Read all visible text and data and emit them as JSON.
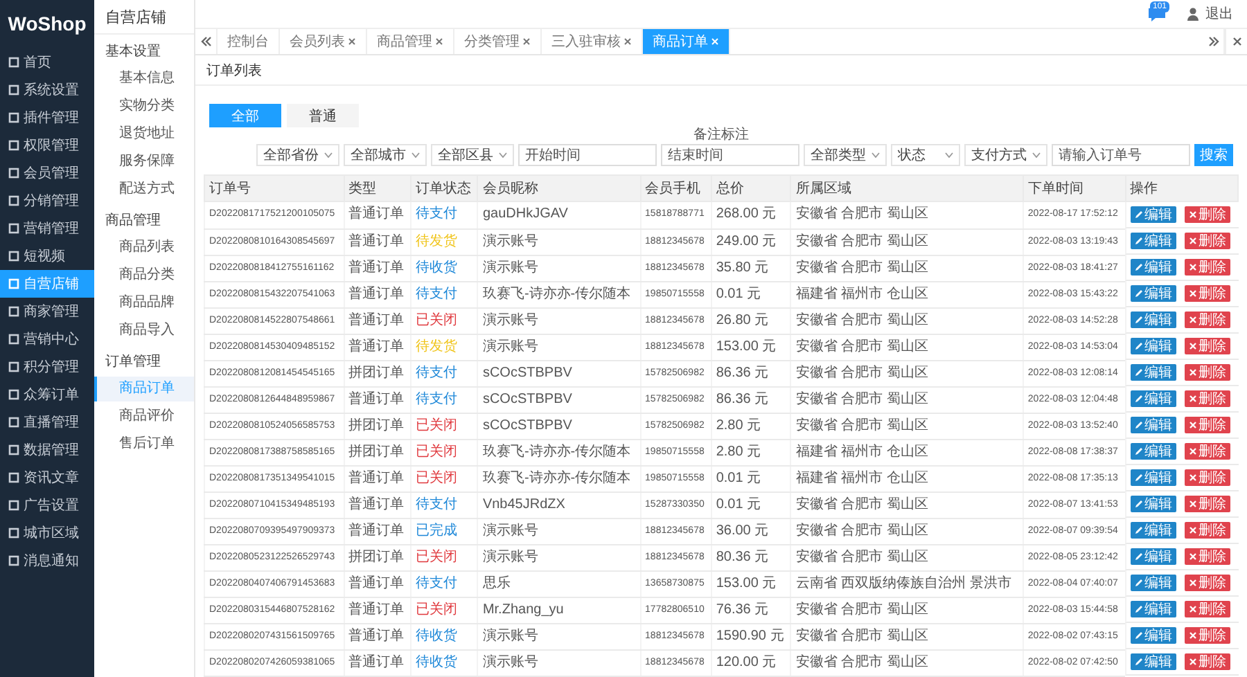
{
  "sidebar": {
    "logo": "WoShop",
    "items": [
      {
        "label": "首页",
        "selected": false
      },
      {
        "label": "系统设置",
        "selected": false
      },
      {
        "label": "插件管理",
        "selected": false
      },
      {
        "label": "权限管理",
        "selected": false
      },
      {
        "label": "会员管理",
        "selected": false
      },
      {
        "label": "分销管理",
        "selected": false
      },
      {
        "label": "营销管理",
        "selected": false
      },
      {
        "label": "短视频",
        "selected": false
      },
      {
        "label": "自营店铺",
        "selected": true
      },
      {
        "label": "商家管理",
        "selected": false
      },
      {
        "label": "营销中心",
        "selected": false
      },
      {
        "label": "积分管理",
        "selected": false
      },
      {
        "label": "众筹订单",
        "selected": false
      },
      {
        "label": "直播管理",
        "selected": false
      },
      {
        "label": "数据管理",
        "selected": false
      },
      {
        "label": "资讯文章",
        "selected": false
      },
      {
        "label": "广告设置",
        "selected": false
      },
      {
        "label": "城市区域",
        "selected": false
      },
      {
        "label": "消息通知",
        "selected": false
      }
    ]
  },
  "subnav": {
    "title": "自营店铺",
    "groups": [
      {
        "label": "基本设置",
        "items": [
          {
            "label": "基本信息",
            "selected": false
          },
          {
            "label": "实物分类",
            "selected": false
          },
          {
            "label": "退货地址",
            "selected": false
          },
          {
            "label": "服务保障",
            "selected": false
          },
          {
            "label": "配送方式",
            "selected": false
          }
        ]
      },
      {
        "label": "商品管理",
        "items": [
          {
            "label": "商品列表",
            "selected": false
          },
          {
            "label": "商品分类",
            "selected": false
          },
          {
            "label": "商品品牌",
            "selected": false
          },
          {
            "label": "商品导入",
            "selected": false
          }
        ]
      },
      {
        "label": "订单管理",
        "items": [
          {
            "label": "商品订单",
            "selected": true
          },
          {
            "label": "商品评价",
            "selected": false
          },
          {
            "label": "售后订单",
            "selected": false
          }
        ]
      }
    ]
  },
  "header": {
    "badge": "101",
    "logout": "退出"
  },
  "tabs": [
    {
      "label": "控制台",
      "selected": false,
      "closable": false
    },
    {
      "label": "会员列表",
      "selected": false,
      "closable": true
    },
    {
      "label": "商品管理",
      "selected": false,
      "closable": true
    },
    {
      "label": "分类管理",
      "selected": false,
      "closable": true
    },
    {
      "label": "三入驻审核",
      "selected": false,
      "closable": true
    },
    {
      "label": "商品订单",
      "selected": true,
      "closable": true
    }
  ],
  "page_title": "订单列表",
  "type_buttons": [
    {
      "label": "全部",
      "selected": true
    },
    {
      "label": "普通",
      "selected": false
    }
  ],
  "filters": {
    "label": "备注标注",
    "controls": [
      {
        "kind": "select",
        "text": "全部省份"
      },
      {
        "kind": "select",
        "text": "全部城市"
      },
      {
        "kind": "select",
        "text": "全部区县"
      },
      {
        "kind": "input",
        "placeholder": "开始时间"
      },
      {
        "kind": "input",
        "placeholder": "结束时间"
      },
      {
        "kind": "select",
        "text": "全部类型"
      },
      {
        "kind": "select",
        "text": "状态"
      },
      {
        "kind": "select",
        "text": "支付方式"
      },
      {
        "kind": "input",
        "placeholder": "请输入订单号"
      },
      {
        "kind": "button",
        "text": "搜索"
      }
    ]
  },
  "table": {
    "columns": [
      "订单号",
      "类型",
      "订单状态",
      "会员昵称",
      "会员手机",
      "总价",
      "所属区域",
      "下单时间",
      "操作"
    ],
    "rows": [
      {
        "order_no": "D2022081717521200105075",
        "type": "普通订单",
        "status": {
          "text": "待支付",
          "color": "#1e88d8"
        },
        "nickname": "gauDHkJGAV",
        "phone": "15818788771",
        "total": "268.00 元",
        "region": "安徽省 合肥市 蜀山区",
        "time": "2022-08-17 17:52:12",
        "edit": "编辑",
        "delete": "删除"
      },
      {
        "order_no": "D2022080810164308545697",
        "type": "普通订单",
        "status": {
          "text": "待发货",
          "color": "#f0c419"
        },
        "nickname": "演示账号",
        "phone": "18812345678",
        "total": "249.00 元",
        "region": "安徽省 合肥市 蜀山区",
        "time": "2022-08-03 13:19:43",
        "edit": "编辑",
        "delete": "删除"
      },
      {
        "order_no": "D2022080818412755161162",
        "type": "普通订单",
        "status": {
          "text": "待收货",
          "color": "#1e88d8"
        },
        "nickname": "演示账号",
        "phone": "18812345678",
        "total": "35.80 元",
        "region": "安徽省 合肥市 蜀山区",
        "time": "2022-08-03 18:41:27",
        "edit": "编辑",
        "delete": "删除"
      },
      {
        "order_no": "D2022080815432207541063",
        "type": "普通订单",
        "status": {
          "text": "待支付",
          "color": "#1e88d8"
        },
        "nickname": "玖赛飞-诗亦亦-传尔随本",
        "phone": "19850715558",
        "total": "0.01 元",
        "region": "福建省 福州市 仓山区",
        "time": "2022-08-03 15:43:22",
        "edit": "编辑",
        "delete": "删除"
      },
      {
        "order_no": "D2022080814522807548661",
        "type": "普通订单",
        "status": {
          "text": "已关闭",
          "color": "#e0393e"
        },
        "nickname": "演示账号",
        "phone": "18812345678",
        "total": "26.80 元",
        "region": "安徽省 合肥市 蜀山区",
        "time": "2022-08-03 14:52:28",
        "edit": "编辑",
        "delete": "删除"
      },
      {
        "order_no": "D2022080814530409485152",
        "type": "普通订单",
        "status": {
          "text": "待发货",
          "color": "#f0c419"
        },
        "nickname": "演示账号",
        "phone": "18812345678",
        "total": "153.00 元",
        "region": "安徽省 合肥市 蜀山区",
        "time": "2022-08-03 14:53:04",
        "edit": "编辑",
        "delete": "删除"
      },
      {
        "order_no": "D2022080812081454545165",
        "type": "拼团订单",
        "status": {
          "text": "待支付",
          "color": "#1e88d8"
        },
        "nickname": "sCOcSTBPBV",
        "phone": "15782506982",
        "total": "86.36 元",
        "region": "安徽省 合肥市 蜀山区",
        "time": "2022-08-03 12:08:14",
        "edit": "编辑",
        "delete": "删除"
      },
      {
        "order_no": "D2022080812644848959867",
        "type": "普通订单",
        "status": {
          "text": "待支付",
          "color": "#1e88d8"
        },
        "nickname": "sCOcSTBPBV",
        "phone": "15782506982",
        "total": "86.36 元",
        "region": "安徽省 合肥市 蜀山区",
        "time": "2022-08-03 12:04:48",
        "edit": "编辑",
        "delete": "删除"
      },
      {
        "order_no": "D2022080810524056585753",
        "type": "拼团订单",
        "status": {
          "text": "已关闭",
          "color": "#e0393e"
        },
        "nickname": "sCOcSTBPBV",
        "phone": "15782506982",
        "total": "2.80 元",
        "region": "安徽省 合肥市 蜀山区",
        "time": "2022-08-03 13:52:40",
        "edit": "编辑",
        "delete": "删除"
      },
      {
        "order_no": "D2022080817388758585165",
        "type": "拼团订单",
        "status": {
          "text": "已关闭",
          "color": "#e0393e"
        },
        "nickname": "玖赛飞-诗亦亦-传尔随本",
        "phone": "19850715558",
        "total": "2.80 元",
        "region": "福建省 福州市 仓山区",
        "time": "2022-08-08 17:38:37",
        "edit": "编辑",
        "delete": "删除"
      },
      {
        "order_no": "D2022080817351349541015",
        "type": "普通订单",
        "status": {
          "text": "已关闭",
          "color": "#e0393e"
        },
        "nickname": "玖赛飞-诗亦亦-传尔随本",
        "phone": "19850715558",
        "total": "0.01 元",
        "region": "福建省 福州市 仓山区",
        "time": "2022-08-08 17:35:13",
        "edit": "编辑",
        "delete": "删除"
      },
      {
        "order_no": "D2022080710415349485193",
        "type": "普通订单",
        "status": {
          "text": "待支付",
          "color": "#1e88d8"
        },
        "nickname": "Vnb45JRdZX",
        "phone": "15287330350",
        "total": "0.01 元",
        "region": "安徽省 合肥市 蜀山区",
        "time": "2022-08-07 13:41:53",
        "edit": "编辑",
        "delete": "删除"
      },
      {
        "order_no": "D2022080709395497909373",
        "type": "普通订单",
        "status": {
          "text": "已完成",
          "color": "#1e88d8"
        },
        "nickname": "演示账号",
        "phone": "18812345678",
        "total": "36.00 元",
        "region": "安徽省 合肥市 蜀山区",
        "time": "2022-08-07 09:39:54",
        "edit": "编辑",
        "delete": "删除"
      },
      {
        "order_no": "D2022080523122526529743",
        "type": "拼团订单",
        "status": {
          "text": "已关闭",
          "color": "#e0393e"
        },
        "nickname": "演示账号",
        "phone": "18812345678",
        "total": "80.36 元",
        "region": "安徽省 合肥市 蜀山区",
        "time": "2022-08-05 23:12:42",
        "edit": "编辑",
        "delete": "删除"
      },
      {
        "order_no": "D2022080407406791453683",
        "type": "普通订单",
        "status": {
          "text": "待支付",
          "color": "#1e88d8"
        },
        "nickname": "思乐",
        "phone": "13658730875",
        "total": "153.00 元",
        "region": "云南省 西双版纳傣族自治州 景洪市",
        "time": "2022-08-04 07:40:07",
        "edit": "编辑",
        "delete": "删除"
      },
      {
        "order_no": "D2022080315446807528162",
        "type": "普通订单",
        "status": {
          "text": "已关闭",
          "color": "#e0393e"
        },
        "nickname": "Mr.Zhang_yu",
        "phone": "17782806510",
        "total": "76.36 元",
        "region": "安徽省 合肥市 蜀山区",
        "time": "2022-08-03 15:44:58",
        "edit": "编辑",
        "delete": "删除"
      },
      {
        "order_no": "D2022080207431561509765",
        "type": "普通订单",
        "status": {
          "text": "待收货",
          "color": "#1e88d8"
        },
        "nickname": "演示账号",
        "phone": "18812345678",
        "total": "1590.90 元",
        "region": "安徽省 合肥市 蜀山区",
        "time": "2022-08-02 07:43:15",
        "edit": "编辑",
        "delete": "删除"
      },
      {
        "order_no": "D2022080207426059381065",
        "type": "普通订单",
        "status": {
          "text": "待收货",
          "color": "#1e88d8"
        },
        "nickname": "演示账号",
        "phone": "18812345678",
        "total": "120.00 元",
        "region": "安徽省 合肥市 蜀山区",
        "time": "2022-08-02 07:42:50",
        "edit": "编辑",
        "delete": "删除"
      }
    ]
  }
}
